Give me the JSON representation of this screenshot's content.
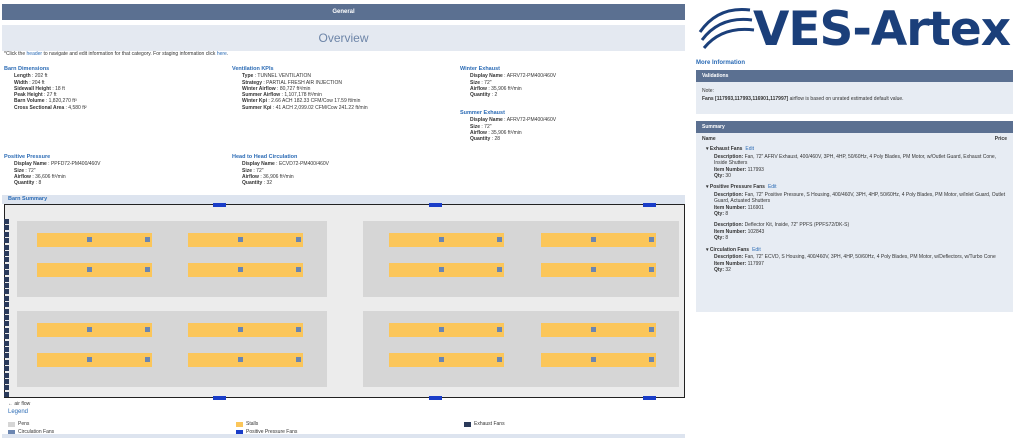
{
  "general": "General",
  "overview": "Overview",
  "hint": {
    "pre": "*Click the ",
    "link1": "header",
    "mid": " to navigate and edit information for that category. For staging information click ",
    "link2": "here",
    "post": "."
  },
  "barn_dimensions": {
    "title": "Barn Dimensions",
    "rows": [
      {
        "k": "Length",
        "v": " : 202 ft"
      },
      {
        "k": "Width",
        "v": " : 204 ft"
      },
      {
        "k": "Sidewall Height",
        "v": " : 18 ft"
      },
      {
        "k": "Peak Height",
        "v": " : 27 ft"
      },
      {
        "k": "Barn Volume",
        "v": " : 1,820,270 ft³"
      },
      {
        "k": "Cross Sectional Area",
        "v": " : 4,580 ft²"
      }
    ]
  },
  "ventilation": {
    "title": "Ventilation KPIs",
    "rows": [
      {
        "k": "Type",
        "v": " : TUNNEL VENTILATION"
      },
      {
        "k": "Strategy",
        "v": " : PARTIAL FRESH AIR INJECTION"
      },
      {
        "k": "Winter Airflow",
        "v": " : 80,727 ft³/min"
      },
      {
        "k": "Summer Airflow",
        "v": " : 1,107,178 ft³/min"
      },
      {
        "k": "Winter Kpi",
        "v": " : 2.66 ACH 182.33 CFM/Cow 17.59 ft/min"
      },
      {
        "k": "Summer Kpi",
        "v": " : 41 ACH 2,099.02 CFM/Cow 241.22 ft/min"
      }
    ]
  },
  "winter_exhaust": {
    "title": "Winter Exhaust",
    "rows": [
      {
        "k": "Display Name",
        "v": " : AFRV72-PM400/460V"
      },
      {
        "k": "Size",
        "v": " : 72\""
      },
      {
        "k": "Airflow",
        "v": " : 35,906 ft³/min"
      },
      {
        "k": "Quantity",
        "v": " : 2"
      }
    ]
  },
  "summer_exhaust": {
    "title": "Summer Exhaust",
    "rows": [
      {
        "k": "Display Name",
        "v": " : AFRV72-PM400/460V"
      },
      {
        "k": "Size",
        "v": " : 72\""
      },
      {
        "k": "Airflow",
        "v": " : 35,906 ft³/min"
      },
      {
        "k": "Quantity",
        "v": " : 28"
      }
    ]
  },
  "positive_pressure": {
    "title": "Positive Pressure",
    "rows": [
      {
        "k": "Display Name",
        "v": " : PPFD72-PM400/460V"
      },
      {
        "k": "Size",
        "v": " : 72\""
      },
      {
        "k": "Airflow",
        "v": " : 36,606 ft³/min"
      },
      {
        "k": "Quantity",
        "v": " : 8"
      }
    ]
  },
  "head_to_head": {
    "title": "Head to Head Circulation",
    "rows": [
      {
        "k": "Display Name",
        "v": " : ECVD72-PM400/460V"
      },
      {
        "k": "Size",
        "v": " : 72\""
      },
      {
        "k": "Airflow",
        "v": " : 36,906 ft³/min"
      },
      {
        "k": "Quantity",
        "v": " : 32"
      }
    ]
  },
  "barn_summary": "Barn Summary",
  "airflow_label": "← air flow",
  "legend": {
    "title": "Legend",
    "pens": "Pens",
    "stalls": "Stalls",
    "exhaust": "Exhaust Fans",
    "circulation": "Circulation Fans",
    "positive": "Positive Pressure Fans"
  },
  "colors": {
    "header": "#5b7091",
    "pens": "#d6d6d6",
    "stalls": "#fbc65a",
    "circulation": "#6b86b1",
    "positive": "#1a3dc8",
    "exhaust": "#2a3a5a"
  },
  "right": {
    "logo": "VES-Artex",
    "more_info": "More Information",
    "validations": {
      "title": "Validations",
      "note": "Note:",
      "message_bold": "Fans [117993,117993,116901,117997]",
      "message_rest": " airflow is based on unrated estimated default value."
    },
    "summary": {
      "title": "Summary",
      "col_name": "Name",
      "col_price": "Price",
      "edit": "Edit",
      "groups": [
        {
          "name": "Exhaust Fans",
          "items": [
            {
              "desc": "Fan, 72\" AFRV Exhaust, 400/460V, 3PH, 4HP, 50/60Hz, 4 Poly Blades, PM Motor, w/Outlet Guard, Exhaust Cone, Inside Shutters",
              "item": "117993",
              "qty": "30"
            }
          ]
        },
        {
          "name": "Positive Pressure Fans",
          "items": [
            {
              "desc": "Fan, 72\" Positive Pressure, S Housing, 400/460V, 3PH, 4HP, 50/60Hz, 4 Poly Blades, PM Motor, w/Inlet Guard, Outlet Guard, Actuated Shutters",
              "item": "116901",
              "qty": "8"
            },
            {
              "desc": "Deflector Kit, Inside, 72\" PPFS (PPFS72/DK-S)",
              "item": "102843",
              "qty": "8"
            }
          ]
        },
        {
          "name": "Circulation Fans",
          "items": [
            {
              "desc": "Fan, 72\" ECVD, S Housing, 400/460V, 3PH, 4HP, 50/60Hz, 4 Poly Blades, PM Motor, w/Deflectors, w/Turbo Cone",
              "item": "117997",
              "qty": "32"
            }
          ]
        }
      ],
      "labels": {
        "description": "Description:",
        "item_number": "Item Number:",
        "qty": "Qty:"
      }
    }
  }
}
